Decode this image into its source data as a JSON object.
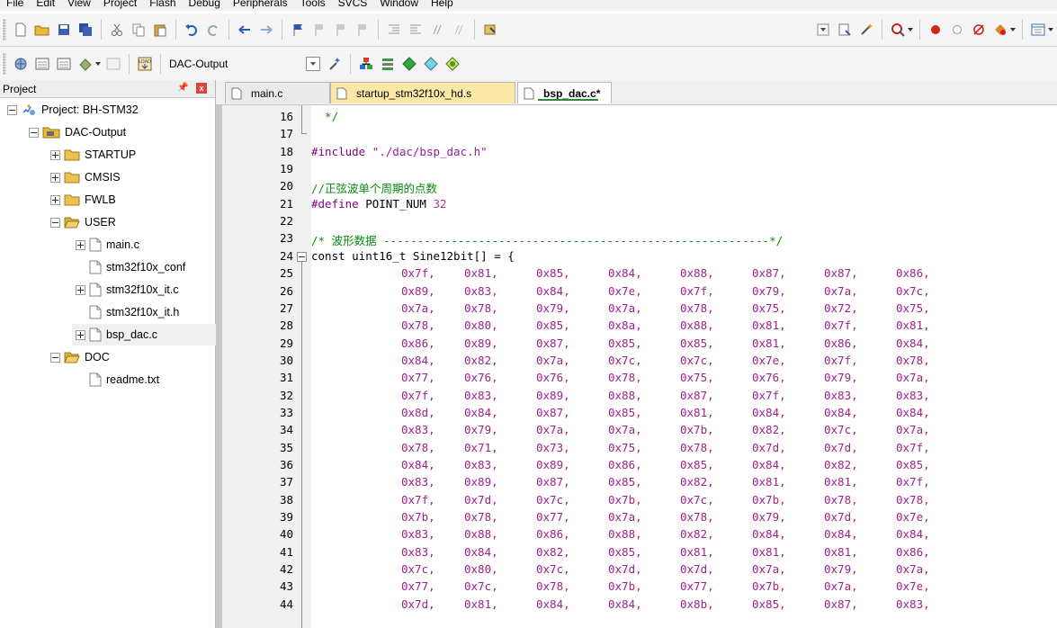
{
  "menu": [
    "File",
    "Edit",
    "View",
    "Project",
    "Flash",
    "Debug",
    "Peripherals",
    "Tools",
    "SVCS",
    "Window",
    "Help"
  ],
  "toolbar": {
    "row1_icons": [
      "new-file-icon",
      "open-folder-icon",
      "save-icon",
      "save-all-icon",
      "cut-icon",
      "copy-icon",
      "paste-icon",
      "undo-icon",
      "redo-icon",
      "navigate-back-icon",
      "navigate-forward-icon",
      "bookmark-icon",
      "prev-bookmark-icon",
      "next-bookmark-icon",
      "clear-bookmarks-icon",
      "indent-icon",
      "unindent-icon",
      "comment-icon",
      "uncomment-icon",
      "find-in-files-icon"
    ],
    "row1_right_icons": [
      "dropdown-icon",
      "configure-icon",
      "magic-wand-icon",
      "debug-session-icon",
      "breakpoint-icon",
      "disable-breakpoint-icon",
      "kill-breakpoints-icon",
      "trace-icon",
      "window-layout-icon"
    ],
    "row2_icons": [
      "translate-icon",
      "build-icon",
      "rebuild-icon",
      "batch-build-icon",
      "stop-build-icon",
      "download-icon"
    ],
    "load_label": "LOAD",
    "target": "DAC-Output",
    "row2_right_icons": [
      "target-options-icon",
      "file-extensions-icon",
      "manage-components-icon",
      "select-packs-icon",
      "pack-installer-icon"
    ]
  },
  "project_panel": {
    "title": "Project",
    "pin": "ᵖ",
    "close": "x",
    "tree": [
      {
        "label": "Project: BH-STM32",
        "level": 0,
        "expanded": true,
        "icon": "project-icon"
      },
      {
        "label": "DAC-Output",
        "level": 1,
        "expanded": true,
        "icon": "target-folder-icon"
      },
      {
        "label": "STARTUP",
        "level": 2,
        "expanded": false,
        "icon": "folder-icon"
      },
      {
        "label": "CMSIS",
        "level": 2,
        "expanded": false,
        "icon": "folder-icon"
      },
      {
        "label": "FWLB",
        "level": 2,
        "expanded": false,
        "icon": "folder-icon"
      },
      {
        "label": "USER",
        "level": 2,
        "expanded": true,
        "icon": "folder-open-icon"
      },
      {
        "label": "main.c",
        "level": 3,
        "expanded": false,
        "icon": "file-icon"
      },
      {
        "label": "stm32f10x_conf",
        "level": 3,
        "leaf": true,
        "icon": "file-icon"
      },
      {
        "label": "stm32f10x_it.c",
        "level": 3,
        "expanded": false,
        "icon": "file-icon"
      },
      {
        "label": "stm32f10x_it.h",
        "level": 3,
        "leaf": true,
        "icon": "file-icon"
      },
      {
        "label": "bsp_dac.c",
        "level": 3,
        "expanded": false,
        "icon": "file-icon",
        "selected": true
      },
      {
        "label": "DOC",
        "level": 2,
        "expanded": true,
        "icon": "folder-open-icon"
      },
      {
        "label": "readme.txt",
        "level": 3,
        "leaf": true,
        "icon": "file-icon"
      }
    ]
  },
  "tabs": [
    {
      "label": "main.c",
      "active": false,
      "color": "default"
    },
    {
      "label": "startup_stm32f10x_hd.s",
      "active": false,
      "color": "yellow"
    },
    {
      "label": "bsp_dac.c*",
      "active": true,
      "color": "default"
    }
  ],
  "code_header": [
    {
      "n": "16",
      "parts": [
        {
          "t": "  */",
          "c": "comment"
        }
      ]
    },
    {
      "n": "17",
      "parts": []
    },
    {
      "n": "18",
      "parts": [
        {
          "t": "#include ",
          "c": "pp"
        },
        {
          "t": "\"./dac/bsp_dac.h\"",
          "c": "str"
        }
      ]
    },
    {
      "n": "19",
      "parts": []
    },
    {
      "n": "20",
      "parts": [
        {
          "t": "//正弦波单个周期的点数",
          "c": "comment"
        }
      ]
    },
    {
      "n": "21",
      "parts": [
        {
          "t": "#define ",
          "c": "pp"
        },
        {
          "t": "POINT_NUM ",
          "c": "plain"
        },
        {
          "t": "32",
          "c": "num"
        }
      ]
    },
    {
      "n": "22",
      "parts": []
    },
    {
      "n": "23",
      "parts": [
        {
          "t": "/* 波形数据 ---------------------------------------------------------*/",
          "c": "comment"
        }
      ]
    },
    {
      "n": "24",
      "parts": [
        {
          "t": "const uint16_t Sine12bit[] = {",
          "c": "plain"
        }
      ]
    }
  ],
  "table_start_line": 25,
  "table_rows": [
    [
      "0x7f,",
      "0x81,",
      "0x85,",
      "0x84,",
      "0x88,",
      "0x87,",
      "0x87,",
      "0x86,"
    ],
    [
      "0x89,",
      "0x83,",
      "0x84,",
      "0x7e,",
      "0x7f,",
      "0x79,",
      "0x7a,",
      "0x7c,"
    ],
    [
      "0x7a,",
      "0x78,",
      "0x79,",
      "0x7a,",
      "0x78,",
      "0x75,",
      "0x72,",
      "0x75,"
    ],
    [
      "0x78,",
      "0x80,",
      "0x85,",
      "0x8a,",
      "0x88,",
      "0x81,",
      "0x7f,",
      "0x81,"
    ],
    [
      "0x86,",
      "0x89,",
      "0x87,",
      "0x85,",
      "0x85,",
      "0x81,",
      "0x86,",
      "0x84,"
    ],
    [
      "0x84,",
      "0x82,",
      "0x7a,",
      "0x7c,",
      "0x7c,",
      "0x7e,",
      "0x7f,",
      "0x78,"
    ],
    [
      "0x77,",
      "0x76,",
      "0x76,",
      "0x78,",
      "0x75,",
      "0x76,",
      "0x79,",
      "0x7a,"
    ],
    [
      "0x7f,",
      "0x83,",
      "0x89,",
      "0x88,",
      "0x87,",
      "0x7f,",
      "0x83,",
      "0x83,"
    ],
    [
      "0x8d,",
      "0x84,",
      "0x87,",
      "0x85,",
      "0x81,",
      "0x84,",
      "0x84,",
      "0x84,"
    ],
    [
      "0x83,",
      "0x79,",
      "0x7a,",
      "0x7a,",
      "0x7b,",
      "0x82,",
      "0x7c,",
      "0x7a,"
    ],
    [
      "0x78,",
      "0x71,",
      "0x73,",
      "0x75,",
      "0x78,",
      "0x7d,",
      "0x7d,",
      "0x7f,"
    ],
    [
      "0x84,",
      "0x83,",
      "0x89,",
      "0x86,",
      "0x85,",
      "0x84,",
      "0x82,",
      "0x85,"
    ],
    [
      "0x83,",
      "0x89,",
      "0x87,",
      "0x85,",
      "0x82,",
      "0x81,",
      "0x81,",
      "0x7f,"
    ],
    [
      "0x7f,",
      "0x7d,",
      "0x7c,",
      "0x7b,",
      "0x7c,",
      "0x7b,",
      "0x78,",
      "0x78,"
    ],
    [
      "0x7b,",
      "0x78,",
      "0x77,",
      "0x7a,",
      "0x78,",
      "0x79,",
      "0x7d,",
      "0x7e,"
    ],
    [
      "0x83,",
      "0x88,",
      "0x86,",
      "0x88,",
      "0x82,",
      "0x84,",
      "0x84,",
      "0x84,"
    ],
    [
      "0x83,",
      "0x84,",
      "0x82,",
      "0x85,",
      "0x81,",
      "0x81,",
      "0x81,",
      "0x86,"
    ],
    [
      "0x7c,",
      "0x80,",
      "0x7c,",
      "0x7d,",
      "0x7d,",
      "0x7a,",
      "0x79,",
      "0x7a,"
    ],
    [
      "0x77,",
      "0x7c,",
      "0x78,",
      "0x7b,",
      "0x77,",
      "0x7b,",
      "0x7a,",
      "0x7e,"
    ],
    [
      "0x7d,",
      "0x81,",
      "0x84,",
      "0x84,",
      "0x8b,",
      "0x85,",
      "0x87,",
      "0x83,"
    ]
  ],
  "colors": {
    "comment": "#0a8a0a",
    "preprocessor": "#7f007f",
    "number": "#a0208f",
    "tab_yellow": "#fbe8a6",
    "gutter": "#f0f0f0"
  }
}
